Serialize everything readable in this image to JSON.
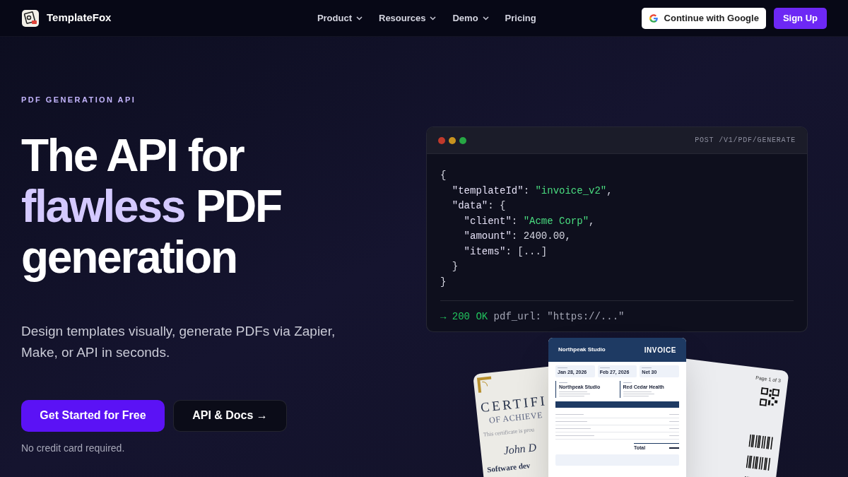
{
  "nav": {
    "brand": "TemplateFox",
    "items": [
      {
        "label": "Product",
        "dropdown": true
      },
      {
        "label": "Resources",
        "dropdown": true
      },
      {
        "label": "Demo",
        "dropdown": true
      },
      {
        "label": "Pricing",
        "dropdown": false
      }
    ],
    "google_button": "Continue with Google",
    "signup_button": "Sign Up"
  },
  "hero": {
    "eyebrow": "PDF GENERATION API",
    "headline": [
      [
        {
          "text": "The API for",
          "highlight": false
        }
      ],
      [
        {
          "text": "flawless",
          "highlight": true
        },
        {
          "text": " PDF",
          "highlight": false
        }
      ],
      [
        {
          "text": "generation",
          "highlight": false
        }
      ]
    ],
    "subtitle": "Design templates visually, generate PDFs via Zapier, Make, or API in seconds.",
    "buttons": [
      {
        "label": "Get Started for Free",
        "kind": "primary"
      },
      {
        "label": "API & Docs →",
        "kind": "secondary"
      }
    ],
    "note": "No credit card required."
  },
  "code_window": {
    "endpoint": "POST /V1/PDF/GENERATE",
    "lines": [
      [
        {
          "text": "{",
          "kind": "punct"
        }
      ],
      [
        {
          "text": "  \"templateId\"",
          "kind": "key"
        },
        {
          "text": ": ",
          "kind": "punct"
        },
        {
          "text": "\"invoice_v2\"",
          "kind": "string"
        },
        {
          "text": ",",
          "kind": "punct"
        }
      ],
      [
        {
          "text": "  \"data\"",
          "kind": "key"
        },
        {
          "text": ": {",
          "kind": "punct"
        }
      ],
      [
        {
          "text": "    \"client\"",
          "kind": "key"
        },
        {
          "text": ": ",
          "kind": "punct"
        },
        {
          "text": "\"Acme Corp\"",
          "kind": "string"
        },
        {
          "text": ",",
          "kind": "punct"
        }
      ],
      [
        {
          "text": "    \"amount\"",
          "kind": "key"
        },
        {
          "text": ": ",
          "kind": "punct"
        },
        {
          "text": "2400.00",
          "kind": "number"
        },
        {
          "text": ",",
          "kind": "punct"
        }
      ],
      [
        {
          "text": "    \"items\"",
          "kind": "key"
        },
        {
          "text": ": [...]",
          "kind": "punct"
        }
      ],
      [
        {
          "text": "  }",
          "kind": "punct"
        }
      ],
      [
        {
          "text": "}",
          "kind": "punct"
        }
      ]
    ],
    "response": [
      {
        "text": "→ 200 OK",
        "kind": "status"
      },
      {
        "text": " pdf_url: \"https://...\"",
        "kind": "muted"
      }
    ]
  },
  "documents": {
    "certificate": {
      "title": "CERTIFI",
      "subtitle": "OF ACHIEVE",
      "line": "This certificate is prou",
      "name": "John D",
      "course": "Software dev"
    },
    "invoice": {
      "company": "Northpeak Studio",
      "title": "INVOICE",
      "dates": [
        "Jan 28, 2026",
        "Feb 27, 2026",
        "Net 30"
      ],
      "parties": [
        "Northpeak Studio",
        "Red Cedar Health"
      ],
      "total_label": "Total"
    },
    "label_sheet": {
      "page": "Page 1 of 3"
    }
  }
}
